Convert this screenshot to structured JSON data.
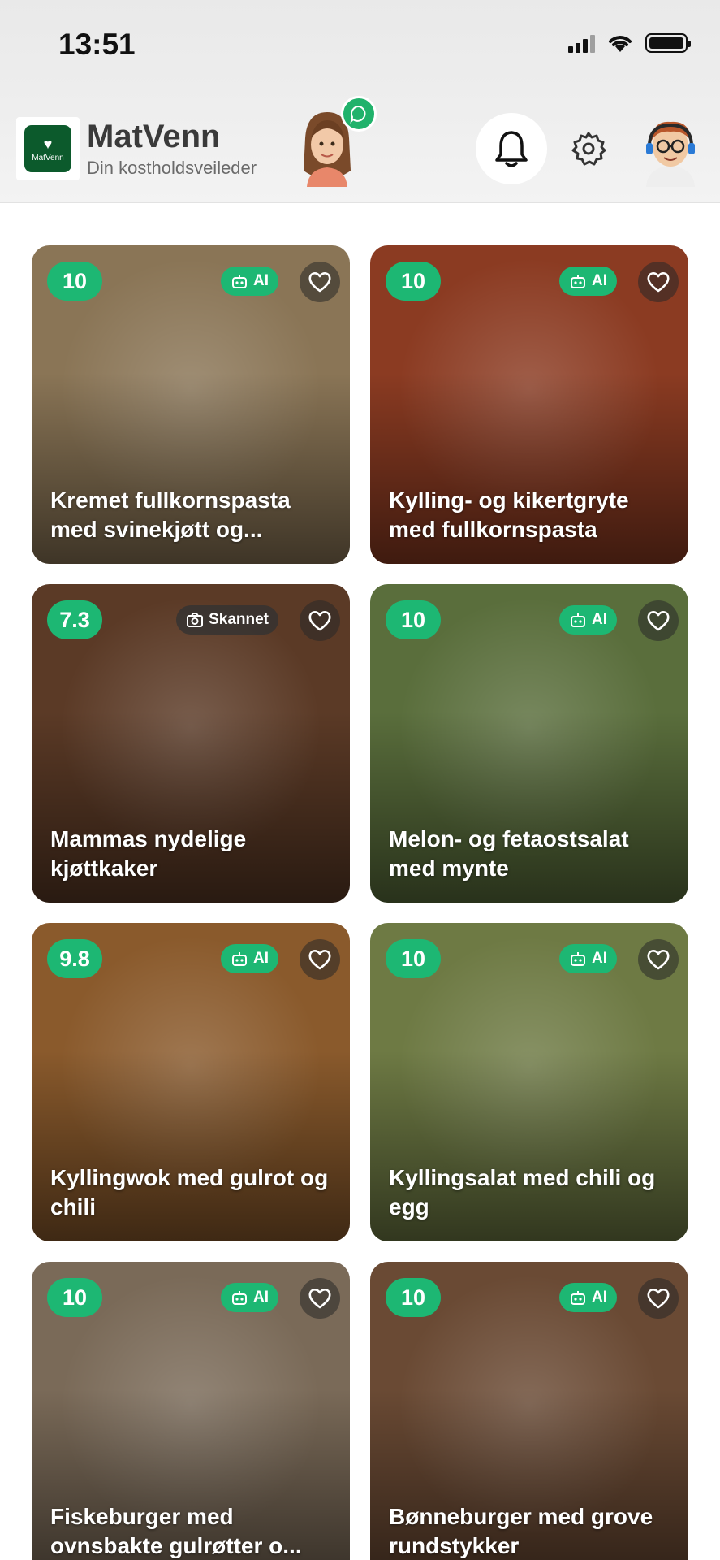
{
  "status_bar": {
    "time": "13:51"
  },
  "header": {
    "logo_text": "MatVenn",
    "title": "MatVenn",
    "subtitle": "Din kostholdsveileder"
  },
  "colors": {
    "brand_green": "#0c5a2c",
    "accent_green": "#1db773",
    "chat_green": "#20b26b"
  },
  "recipes": [
    {
      "score": "10",
      "tag": "AI",
      "tag_type": "ai",
      "title": "Kremet fullkornspasta med svinekjøtt og...",
      "bg": "#8a7556"
    },
    {
      "score": "10",
      "tag": "AI",
      "tag_type": "ai",
      "title": "Kylling- og kikertgryte med fullkornspasta",
      "bg": "#8b3b22"
    },
    {
      "score": "7.3",
      "tag": "Skannet",
      "tag_type": "scan",
      "title": "Mammas nydelige kjøttkaker",
      "bg": "#5b3a26"
    },
    {
      "score": "10",
      "tag": "AI",
      "tag_type": "ai",
      "title": "Melon- og fetaostsalat med mynte",
      "bg": "#5a6e3c"
    },
    {
      "score": "9.8",
      "tag": "AI",
      "tag_type": "ai",
      "title": "Kyllingwok med gulrot og chili",
      "bg": "#8a5a2c"
    },
    {
      "score": "10",
      "tag": "AI",
      "tag_type": "ai",
      "title": "Kyllingsalat med chili og egg",
      "bg": "#6e7a44"
    },
    {
      "score": "10",
      "tag": "AI",
      "tag_type": "ai",
      "title": "Fiskeburger med ovnsbakte gulrøtter o...",
      "bg": "#7a6a58"
    },
    {
      "score": "10",
      "tag": "AI",
      "tag_type": "ai",
      "title": "Bønneburger med grove rundstykker",
      "bg": "#6a4a34"
    }
  ]
}
